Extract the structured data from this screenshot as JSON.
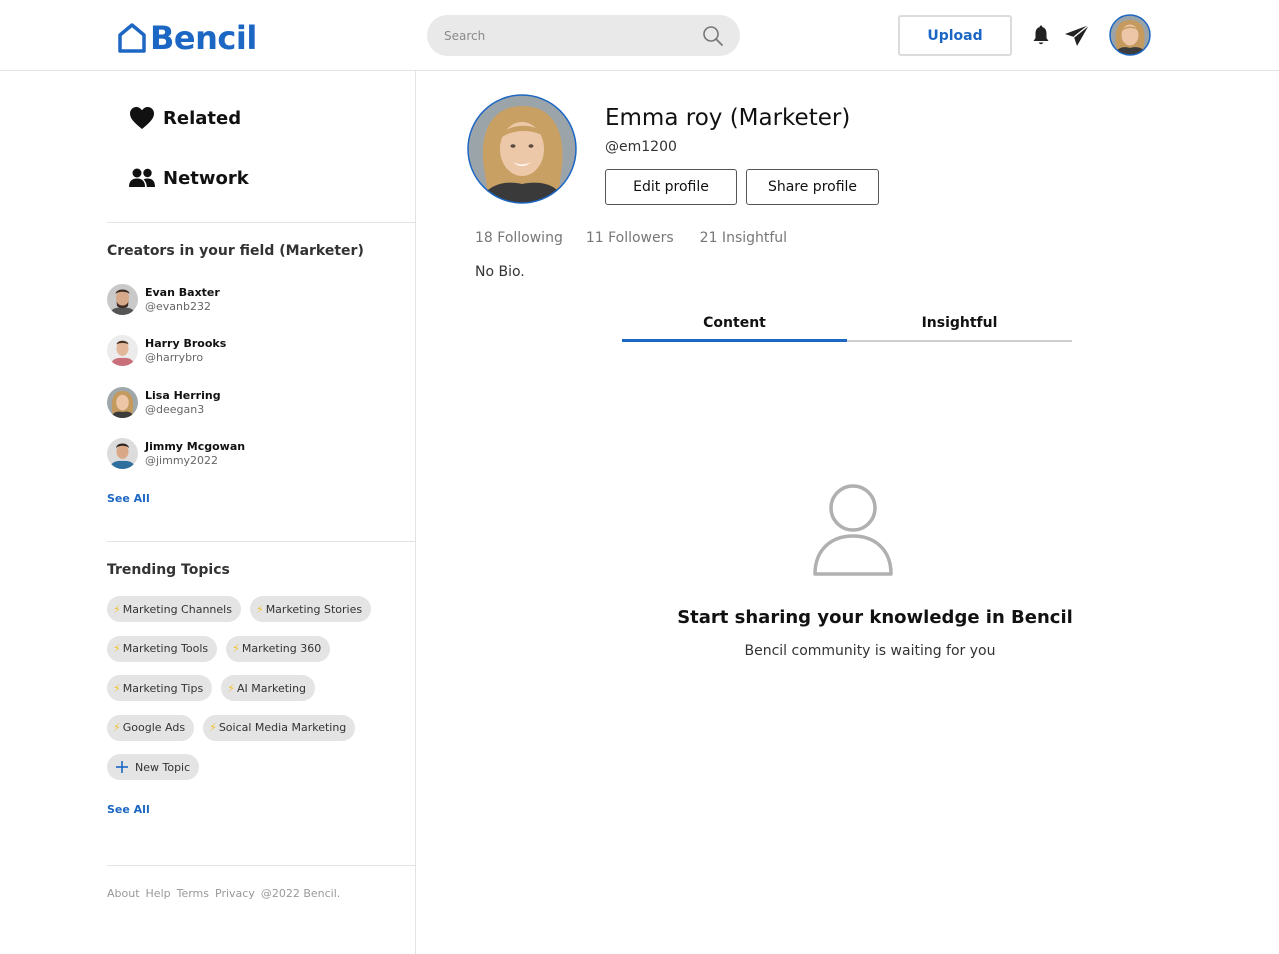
{
  "app": {
    "logo_text": "Bencil",
    "accent_color": "#1d67c4"
  },
  "header": {
    "search": {
      "placeholder": "Search",
      "value": ""
    },
    "upload_label": "Upload",
    "icons": [
      "bell-icon",
      "send-icon",
      "avatar"
    ]
  },
  "sidebar": {
    "nav": [
      {
        "label": "Related",
        "icon": "heart-icon"
      },
      {
        "label": "Network",
        "icon": "people-icon"
      }
    ],
    "creators": {
      "title": "Creators in your field (Marketer)",
      "items": [
        {
          "name": "Evan Baxter",
          "handle": "@evanb232"
        },
        {
          "name": "Harry Brooks",
          "handle": "@harrybro"
        },
        {
          "name": "Lisa Herring",
          "handle": "@deegan3"
        },
        {
          "name": "Jimmy Mcgowan",
          "handle": "@jimmy2022"
        }
      ],
      "see_all": "See All"
    },
    "trending": {
      "title": "Trending Topics",
      "topics": [
        "Marketing Channels",
        "Marketing Stories",
        "Marketing Tools",
        "Marketing 360",
        "Marketing Tips",
        "AI Marketing",
        "Google Ads",
        "Soical Media Marketing"
      ],
      "new_topic": "New Topic",
      "see_all": "See All"
    },
    "footer": [
      "About",
      "Help",
      "Terms",
      "Privacy",
      "@2022 Bencil."
    ]
  },
  "profile": {
    "name": "Emma roy (Marketer)",
    "handle": "@em1200",
    "edit_label": "Edit profile",
    "share_label": "Share profile",
    "stats": {
      "following": "18 Following",
      "followers": "11 Followers",
      "insightful": "21 Insightful"
    },
    "bio": "No Bio."
  },
  "tabs": [
    {
      "label": "Content",
      "active": true
    },
    {
      "label": "Insightful",
      "active": false
    }
  ],
  "empty_state": {
    "title": "Start sharing your knowledge in Bencil",
    "subtitle": "Bencil community is waiting for you"
  }
}
